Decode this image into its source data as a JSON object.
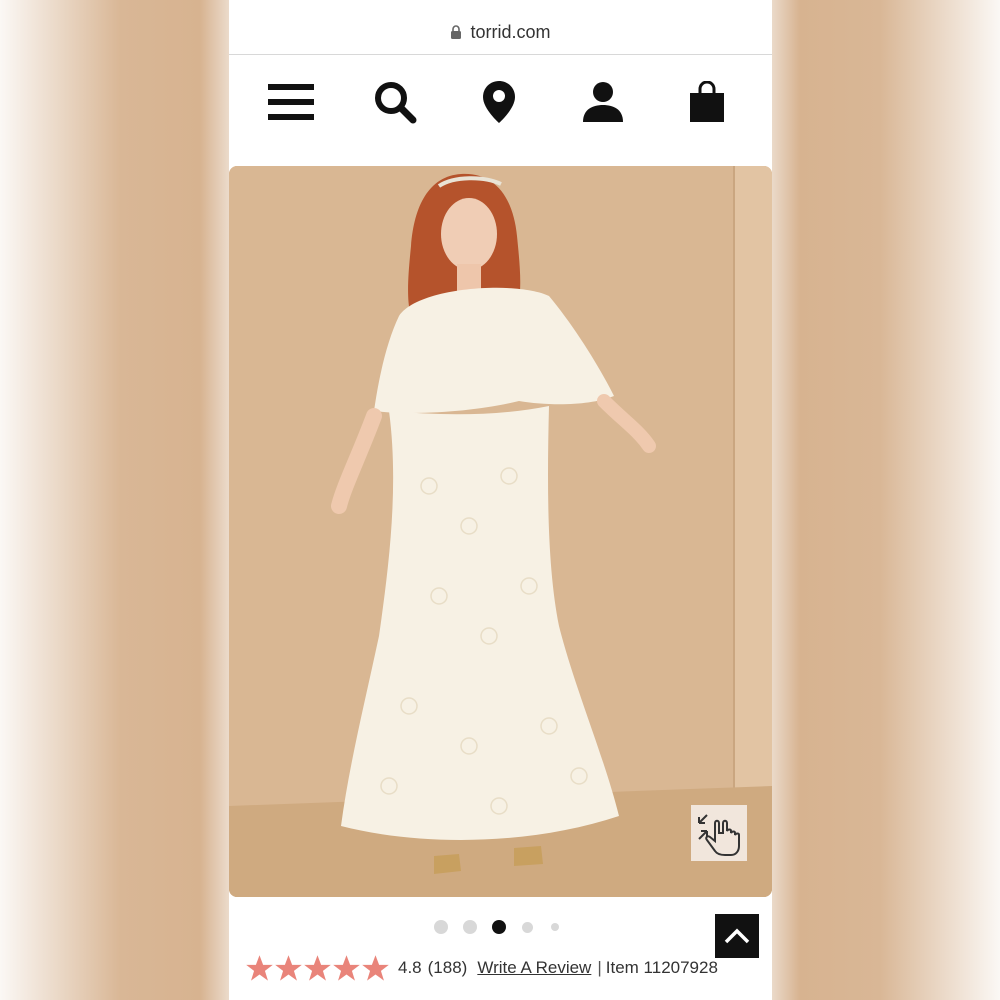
{
  "browser": {
    "url": "torrid.com"
  },
  "nav": {
    "icons": [
      "menu-icon",
      "search-icon",
      "location-pin-icon",
      "account-icon",
      "shopping-bag-icon"
    ]
  },
  "product": {
    "image_alt": "Model wearing ivory lace maxi dress with flutter cape overlay",
    "gallery": {
      "total": 5,
      "active_index": 2
    },
    "rating": 4.8,
    "rating_label": "4.8",
    "review_count_label": "(188)",
    "write_review_label": "Write A Review",
    "separator": "|",
    "item_label": "Item 11207928",
    "stars": 5
  },
  "colors": {
    "star": "#e9847a",
    "backdrop": "#d8b692",
    "dress": "#f7f1e4",
    "hair": "#b5532c",
    "top_button": "#111111"
  }
}
